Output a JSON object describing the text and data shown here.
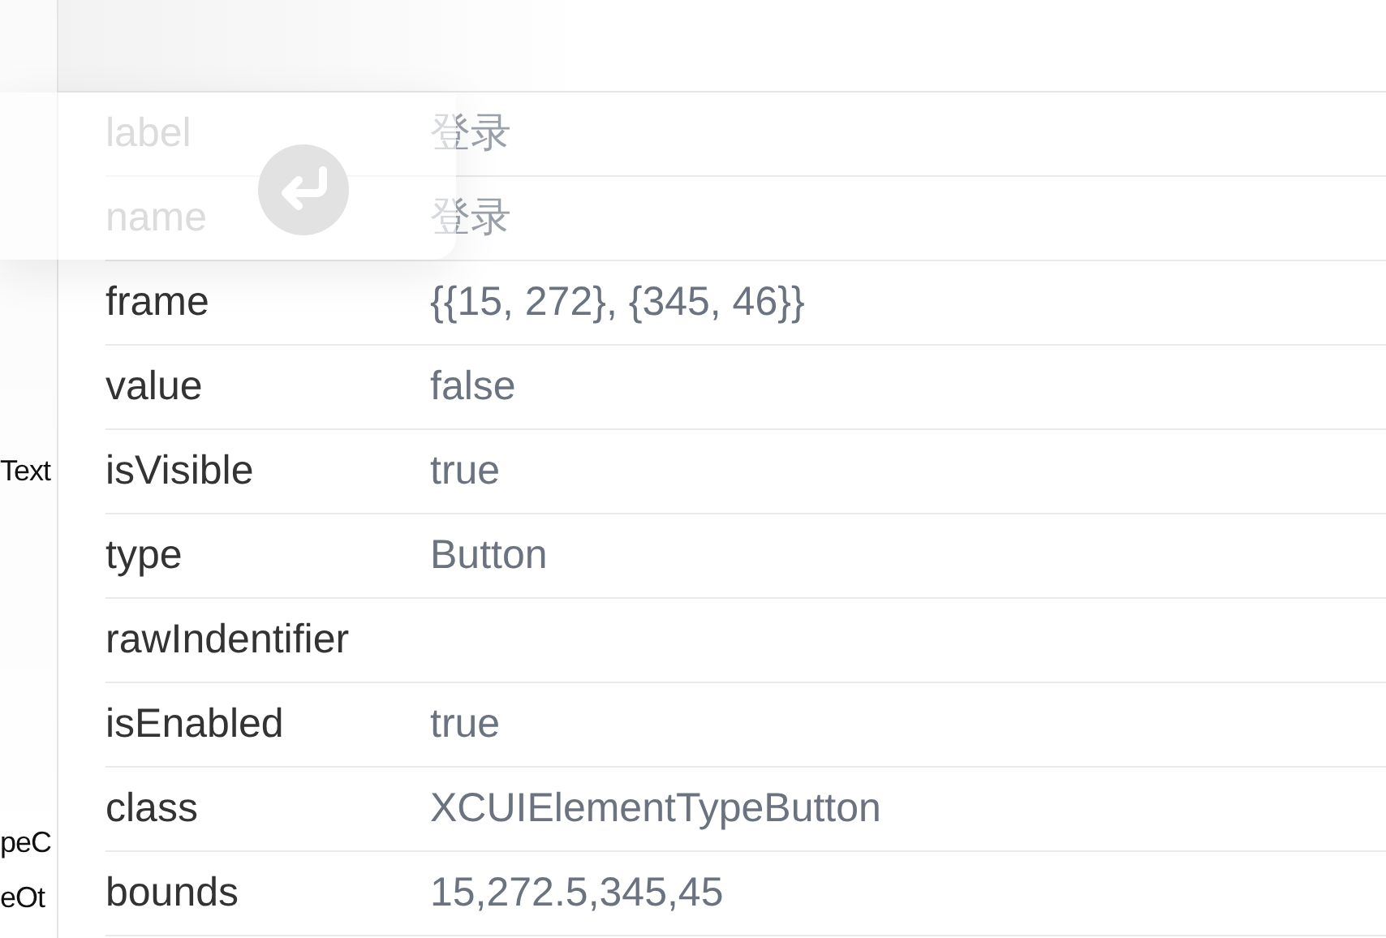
{
  "tree_fragments": [
    {
      "text": "Text"
    },
    {
      "text": "peC"
    },
    {
      "text": "eOt"
    }
  ],
  "properties": [
    {
      "key": "label",
      "value": "登录",
      "dimmed": true
    },
    {
      "key": "name",
      "value": "登录",
      "dimmed": true
    },
    {
      "key": "frame",
      "value": "{{15, 272}, {345, 46}}",
      "dimmed": false
    },
    {
      "key": "value",
      "value": "false",
      "dimmed": false
    },
    {
      "key": "isVisible",
      "value": "true",
      "dimmed": false
    },
    {
      "key": "type",
      "value": "Button",
      "dimmed": false
    },
    {
      "key": "rawIndentifier",
      "dimmed": false
    },
    {
      "key": "isEnabled",
      "value": "true",
      "dimmed": false
    },
    {
      "key": "class",
      "value": "XCUIElementTypeButton",
      "dimmed": false
    },
    {
      "key": "bounds",
      "value": "15,272.5,345,45",
      "dimmed": false
    }
  ]
}
